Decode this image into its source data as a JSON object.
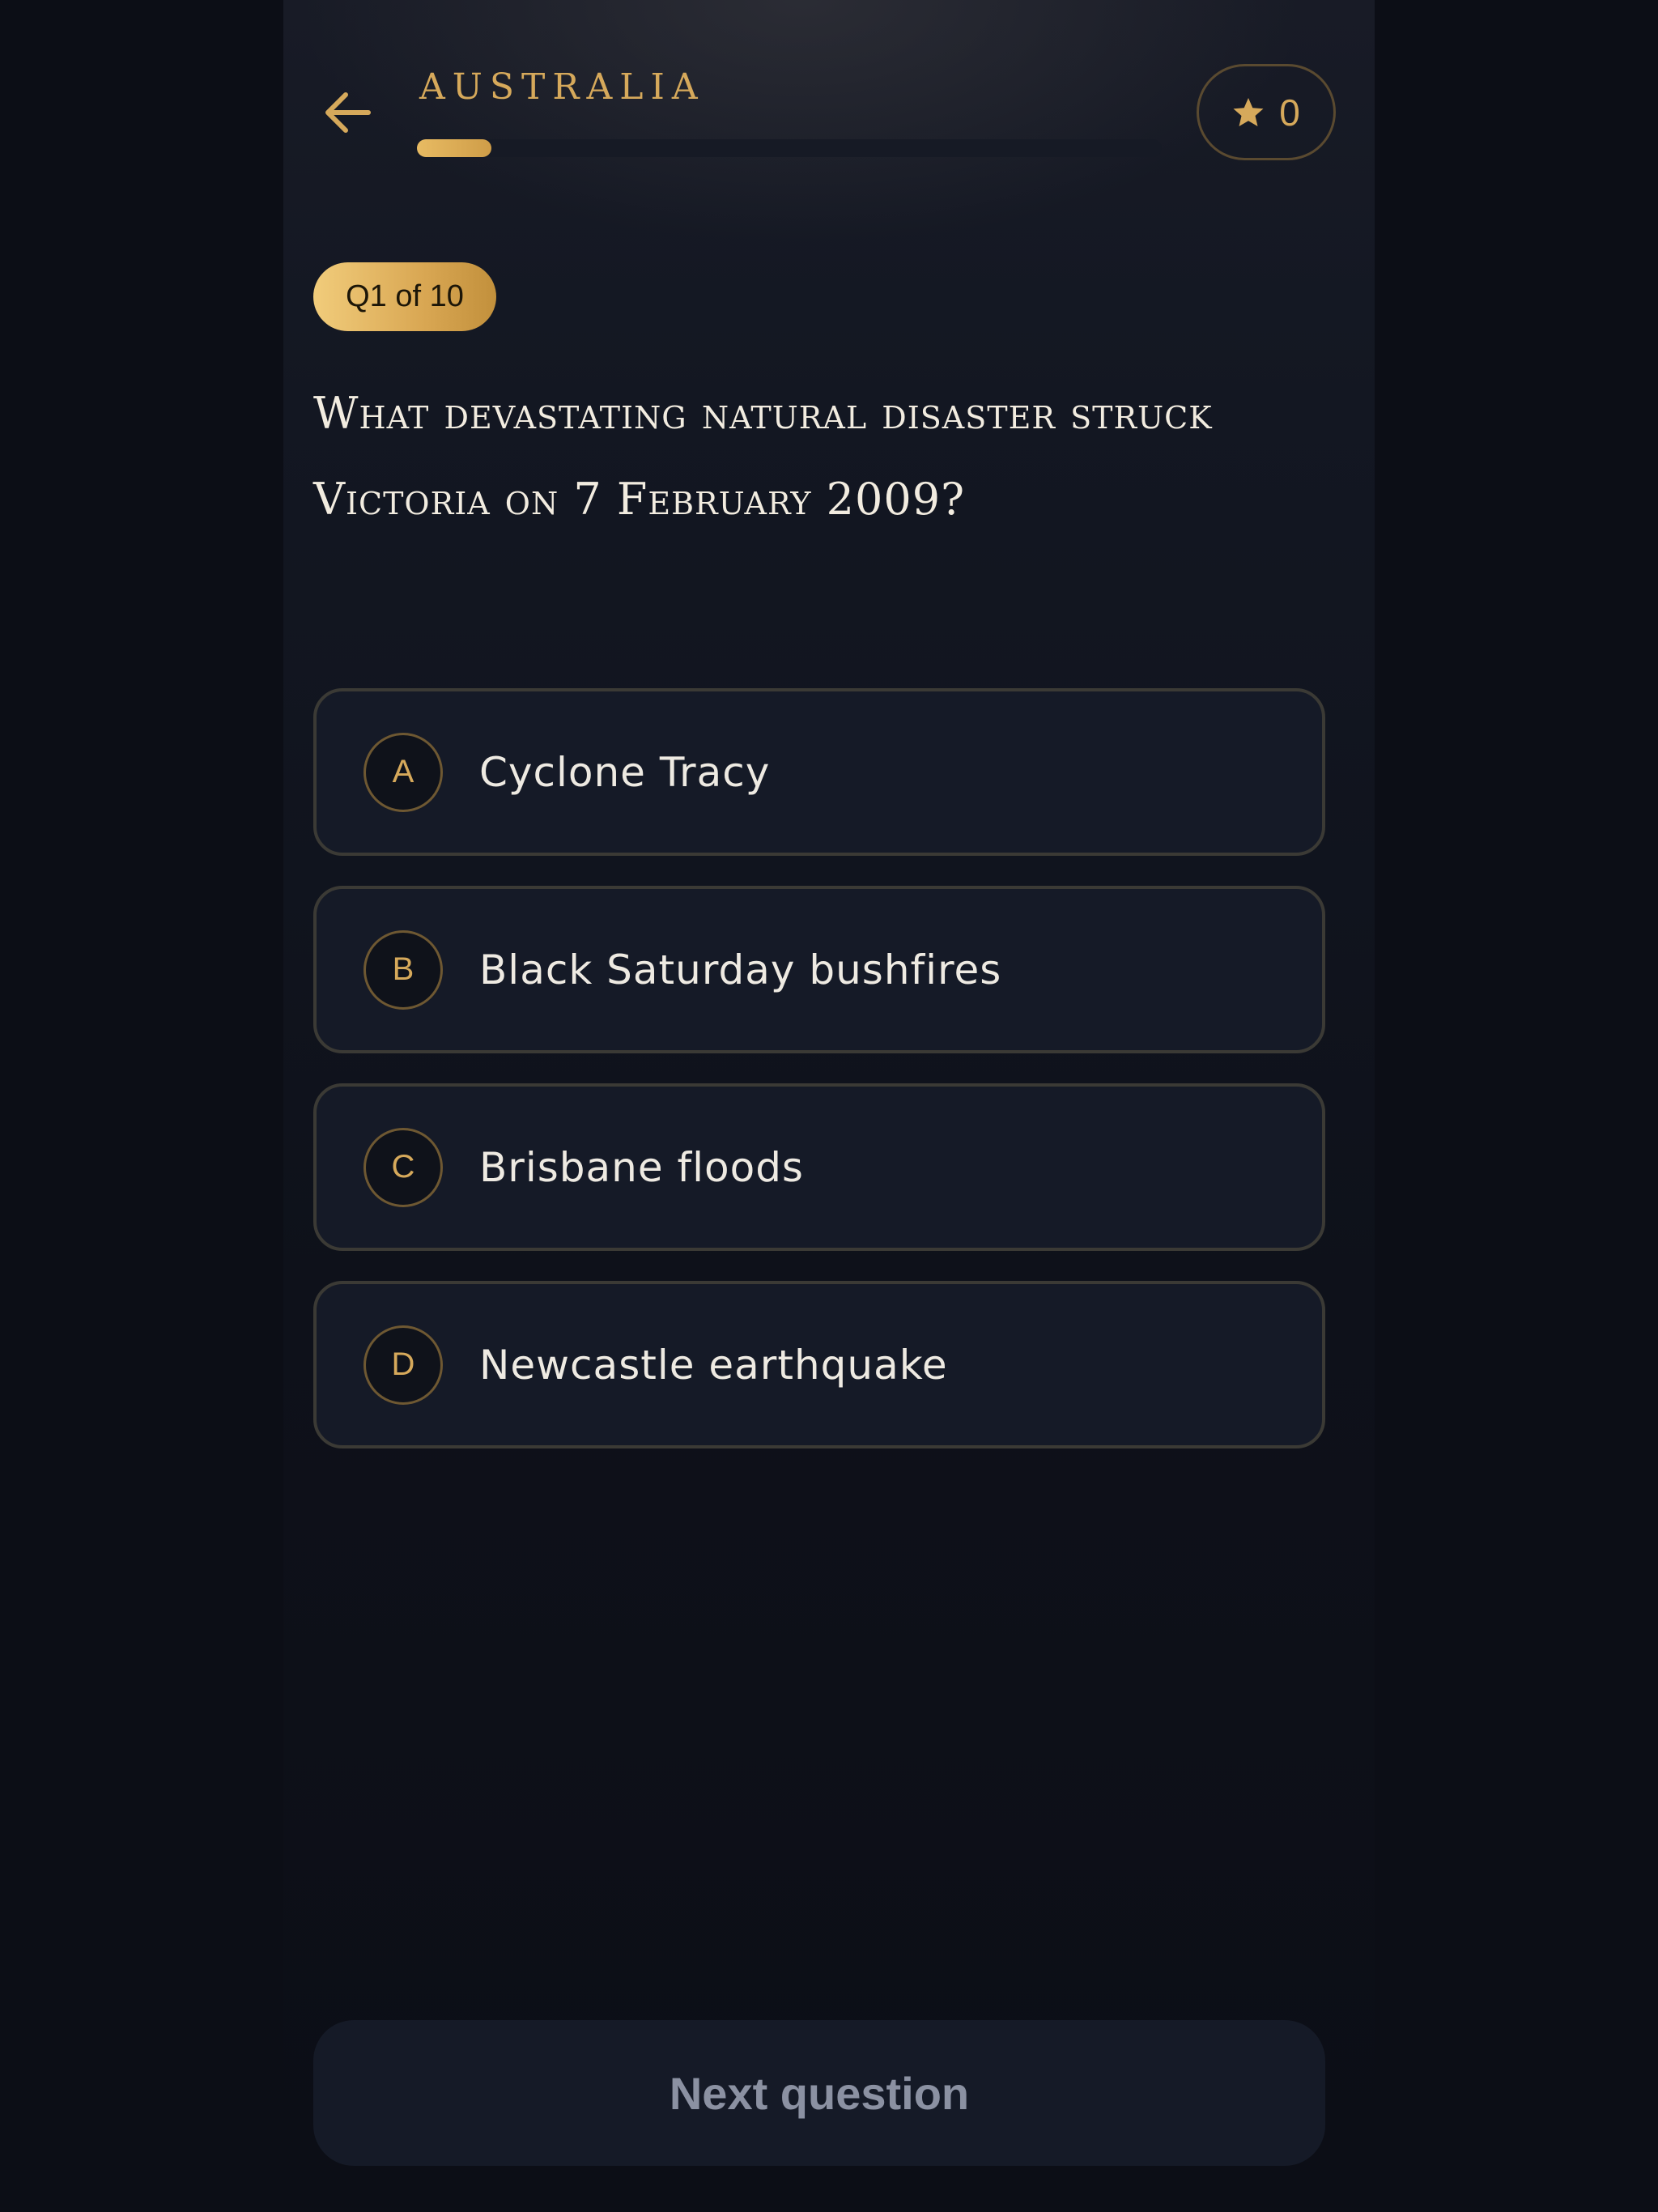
{
  "header": {
    "title": "AUSTRALIA",
    "back_icon": "arrow-left-icon",
    "progress_fraction": 0.1
  },
  "score": {
    "icon": "star-icon",
    "value": "0"
  },
  "quiz": {
    "badge": "Q1 of 10",
    "question": "What devastating natural disaster struck Victoria on 7 February 2009?",
    "options": [
      {
        "letter": "A",
        "text": "Cyclone Tracy"
      },
      {
        "letter": "B",
        "text": "Black Saturday bushfires"
      },
      {
        "letter": "C",
        "text": "Brisbane floods"
      },
      {
        "letter": "D",
        "text": "Newcastle earthquake"
      }
    ]
  },
  "footer": {
    "next_label": "Next question"
  },
  "colors": {
    "accent": "#d6a95b",
    "background": "#0c0e16",
    "card": "#151a27",
    "text": "#f2ece0"
  }
}
